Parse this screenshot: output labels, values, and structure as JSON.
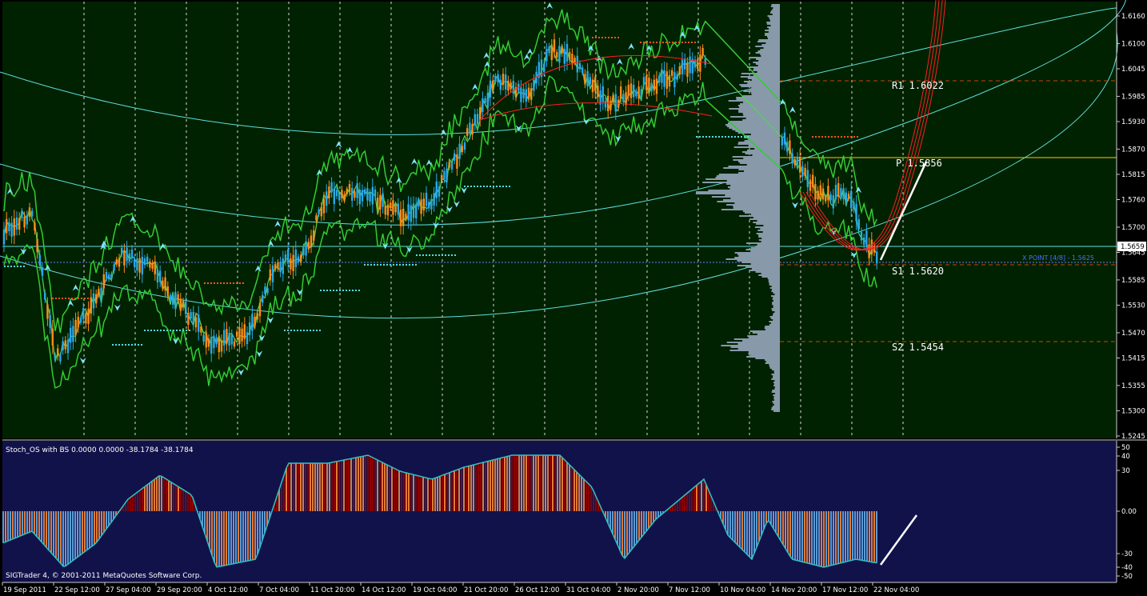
{
  "main_panel": {
    "background": "#002200",
    "price_ticks": [
      "1.6160",
      "1.6100",
      "1.6045",
      "1.5985",
      "1.5930",
      "1.5870",
      "1.5815",
      "1.5760",
      "1.5700",
      "1.5645",
      "1.5585",
      "1.5530",
      "1.5470",
      "1.5415",
      "1.5355",
      "1.5300",
      "1.5245"
    ],
    "current_price": "1.5659",
    "levels": {
      "r1": "R1 1.6022",
      "pivot": "P 1.5856",
      "s1": "S1 1.5620",
      "s2": "S2 1.5454"
    },
    "x_point": "X POINT  [4/8] - 1.5625",
    "colors": {
      "bull": "#ff8c1a",
      "bear": "#2aa8e8",
      "bands": "#33cc33",
      "arcs": "#5fe0e0",
      "pivot": "#ffcc00",
      "resistance": "#cc4400",
      "profile": "#8899aa"
    }
  },
  "indicator_panel": {
    "title": "Stoch_OS with BS 0.0000 0.0000 -38.1784 -38.1784",
    "background": "#12124a",
    "ticks": [
      "50",
      "40",
      "30",
      "0.00",
      "-30",
      "-40",
      "-50"
    ],
    "colors": {
      "high": "#8b0000",
      "mid": "#e07b39",
      "low": "#5b9bd5"
    }
  },
  "time_axis": [
    "19 Sep 2011",
    "22 Sep 12:00",
    "27 Sep 04:00",
    "29 Sep 20:00",
    "4 Oct 12:00",
    "7 Oct 04:00",
    "11 Oct 20:00",
    "14 Oct 12:00",
    "19 Oct 04:00",
    "21 Oct 20:00",
    "26 Oct 12:00",
    "31 Oct 04:00",
    "2 Nov 20:00",
    "7 Nov 12:00",
    "10 Nov 04:00",
    "14 Nov 20:00",
    "17 Nov 12:00",
    "22 Nov 04:00"
  ],
  "footer": "SIGTrader 4, © 2001-2011 MetaQuotes Software Corp."
}
